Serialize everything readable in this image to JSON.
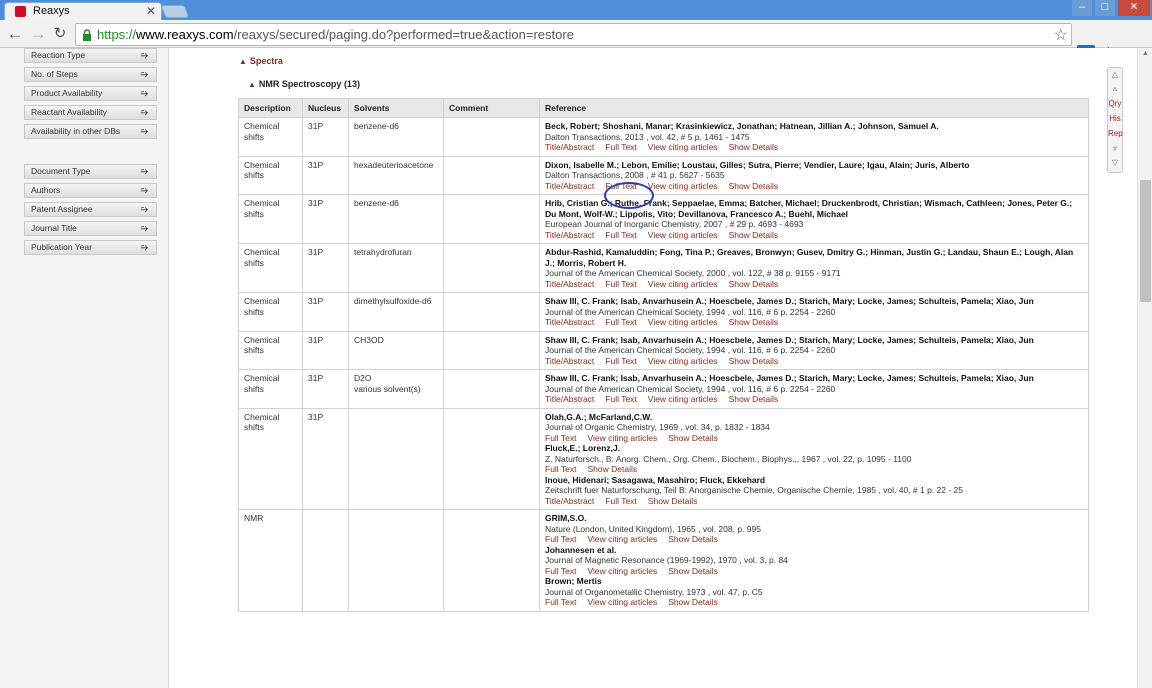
{
  "browser": {
    "tab_title": "Reaxys",
    "url_scheme": "https://",
    "url_host": "www.reaxys.com",
    "url_path": "/reaxys/secured/paging.do?performed=true&action=restore",
    "window_min": "–",
    "window_max": "□",
    "window_close": "✕",
    "star": "☆",
    "menu": "≡",
    "ext_label": "✖"
  },
  "sidebar": {
    "group1": [
      {
        "label": "Reaction Type"
      },
      {
        "label": "No. of Steps"
      },
      {
        "label": "Product Availability"
      },
      {
        "label": "Reactant Availability"
      },
      {
        "label": "Availability in other DBs"
      }
    ],
    "group2": [
      {
        "label": "Document Type"
      },
      {
        "label": "Authors"
      },
      {
        "label": "Patent Assignee"
      },
      {
        "label": "Journal Title"
      },
      {
        "label": "Publication Year"
      }
    ],
    "chevron": "⭇"
  },
  "main": {
    "section_title": "Spectra",
    "subsection_title": "NMR Spectroscopy (13)",
    "columns": [
      "Description",
      "Nucleus",
      "Solvents",
      "Comment",
      "Reference"
    ],
    "rows": [
      {
        "description": "Chemical shifts",
        "nucleus": "31P",
        "solvents": "benzene-d6",
        "comment": "",
        "refs": [
          {
            "authors": "Beck, Robert; Shoshani, Manar; Krasinkiewicz, Jonathan; Hatnean, Jillian A.; Johnson, Samuel A.",
            "journal": "Dalton Transactions, 2013",
            "volume": "vol. 42,  # 5  p. 1461 - 1475",
            "links": [
              "Title/Abstract",
              "Full Text",
              "View citing articles",
              "Show Details"
            ]
          }
        ]
      },
      {
        "description": "Chemical shifts",
        "nucleus": "31P",
        "solvents": "hexadeuterioacetone",
        "comment": "",
        "refs": [
          {
            "authors": "Dixon, Isabelle M.; Lebon, Emilie; Loustau, Gilles; Sutra, Pierre; Vendier, Laure; Igau, Alain; Juris, Alberto",
            "journal": "Dalton Transactions, 2008",
            "volume": "# 41  p. 5627 - 5635",
            "links": [
              "Title/Abstract",
              "Full Text",
              "View citing articles",
              "Show Details"
            ]
          }
        ]
      },
      {
        "description": "Chemical shifts",
        "nucleus": "31P",
        "solvents": "benzene-d6",
        "comment": "",
        "refs": [
          {
            "authors": "Hrib, Cristian G.; Ruthe, Frank; Seppaelae, Emma; Batcher, Michael; Druckenbrodt, Christian; Wismach, Cathleen; Jones, Peter G.; Du Mont, Wolf-W.; Lippolis, Vito; Devillanova, Francesco A.; Buehl, Michael",
            "journal": "European Journal of Inorganic Chemistry, 2007",
            "volume": "# 29  p. 4693 - 4693",
            "links": [
              "Title/Abstract",
              "Full Text",
              "View citing articles",
              "Show Details"
            ]
          }
        ]
      },
      {
        "description": "Chemical shifts",
        "nucleus": "31P",
        "solvents": "tetrahydrofuran",
        "comment": "",
        "refs": [
          {
            "authors": "Abdur-Rashid, Kamaluddin; Fong, Tina P.; Greaves, Bronwyn; Gusev, Dmitry G.; Hinman, Justin G.; Landau, Shaun E.; Lough, Alan J.; Morris, Robert H.",
            "journal": "Journal of the American Chemical Society, 2000",
            "volume": "vol. 122,  # 38  p. 9155 - 9171",
            "links": [
              "Title/Abstract",
              "Full Text",
              "View citing articles",
              "Show Details"
            ]
          }
        ]
      },
      {
        "description": "Chemical shifts",
        "nucleus": "31P",
        "solvents": "dimethylsulfoxide-d6",
        "comment": "",
        "refs": [
          {
            "authors": "Shaw III, C. Frank; Isab, Anvarhusein A.; Hoescbele, James D.; Starich, Mary; Locke, James; Schulteis, Pamela; Xiao, Jun",
            "journal": "Journal of the American Chemical Society, 1994",
            "volume": "vol. 116,  # 6  p. 2254 - 2260",
            "links": [
              "Title/Abstract",
              "Full Text",
              "View citing articles",
              "Show Details"
            ]
          }
        ]
      },
      {
        "description": "Chemical shifts",
        "nucleus": "31P",
        "solvents": "CH3OD",
        "comment": "",
        "refs": [
          {
            "authors": "Shaw III, C. Frank; Isab, Anvarhusein A.; Hoescbele, James D.; Starich, Mary; Locke, James; Schulteis, Pamela; Xiao, Jun",
            "journal": "Journal of the American Chemical Society, 1994",
            "volume": "vol. 116,  # 6  p. 2254 - 2260",
            "links": [
              "Title/Abstract",
              "Full Text",
              "View citing articles",
              "Show Details"
            ]
          }
        ]
      },
      {
        "description": "Chemical shifts",
        "nucleus": "31P",
        "solvents": "D2O\nvarious solvent(s)",
        "comment": "",
        "refs": [
          {
            "authors": "Shaw III, C. Frank; Isab, Anvarhusein A.; Hoescbele, James D.; Starich, Mary; Locke, James; Schulteis, Pamela; Xiao, Jun",
            "journal": "Journal of the American Chemical Society, 1994",
            "volume": "vol. 116,  # 6  p. 2254 - 2260",
            "links": [
              "Title/Abstract",
              "Full Text",
              "View citing articles",
              "Show Details"
            ]
          }
        ]
      },
      {
        "description": "Chemical shifts",
        "nucleus": "31P",
        "solvents": "",
        "comment": "",
        "refs": [
          {
            "authors": "Olah,G.A.; McFarland,C.W.",
            "journal": "Journal of Organic Chemistry, 1969",
            "volume": "vol. 34, p. 1832 - 1834",
            "links": [
              "Full Text",
              "View citing articles",
              "Show Details"
            ]
          },
          {
            "authors": "Fluck,E.; Lorenz,J.",
            "journal": "Z. Naturforsch., B: Anorg. Chem., Org. Chem., Biochem., Biophys.,, 1967",
            "volume": "vol. 22, p. 1095 - 1100",
            "links": [
              "Full Text",
              "Show Details"
            ]
          },
          {
            "authors": "Inoue, Hidenari; Sasagawa, Masahiro; Fluck, Ekkehard",
            "journal": "Zeitschrift fuer Naturforschung, Teil B: Anorganische Chemie, Organische Chemie, 1985",
            "volume": "vol. 40,  # 1  p. 22 - 25",
            "links": [
              "Title/Abstract",
              "Full Text",
              "Show Details"
            ]
          }
        ]
      },
      {
        "description": "NMR",
        "nucleus": "",
        "solvents": "",
        "comment": "",
        "refs": [
          {
            "authors": "GRIM,S.O.",
            "journal": "Nature (London, United Kingdom), 1965",
            "volume": "vol. 208, p. 995",
            "links": [
              "Full Text",
              "View citing articles",
              "Show Details"
            ]
          },
          {
            "authors": "Johannesen et al.",
            "journal": "Journal of Magnetic Resonance (1969-1992), 1970",
            "volume": "vol. 3, p. 84",
            "links": [
              "Full Text",
              "View citing articles",
              "Show Details"
            ]
          },
          {
            "authors": "Brown; Mertis",
            "journal": "Journal of Organometallic Chemistry, 1973",
            "volume": "vol. 47, p. C5",
            "links": [
              "Full Text",
              "View citing articles",
              "Show Details"
            ]
          }
        ]
      }
    ]
  },
  "sidepanel": {
    "qry": "Qry",
    "his": "His",
    "rep": "Rep"
  },
  "colors": {
    "accent": "#8b2b1b",
    "annotation_circle": "#2c3eb0"
  }
}
